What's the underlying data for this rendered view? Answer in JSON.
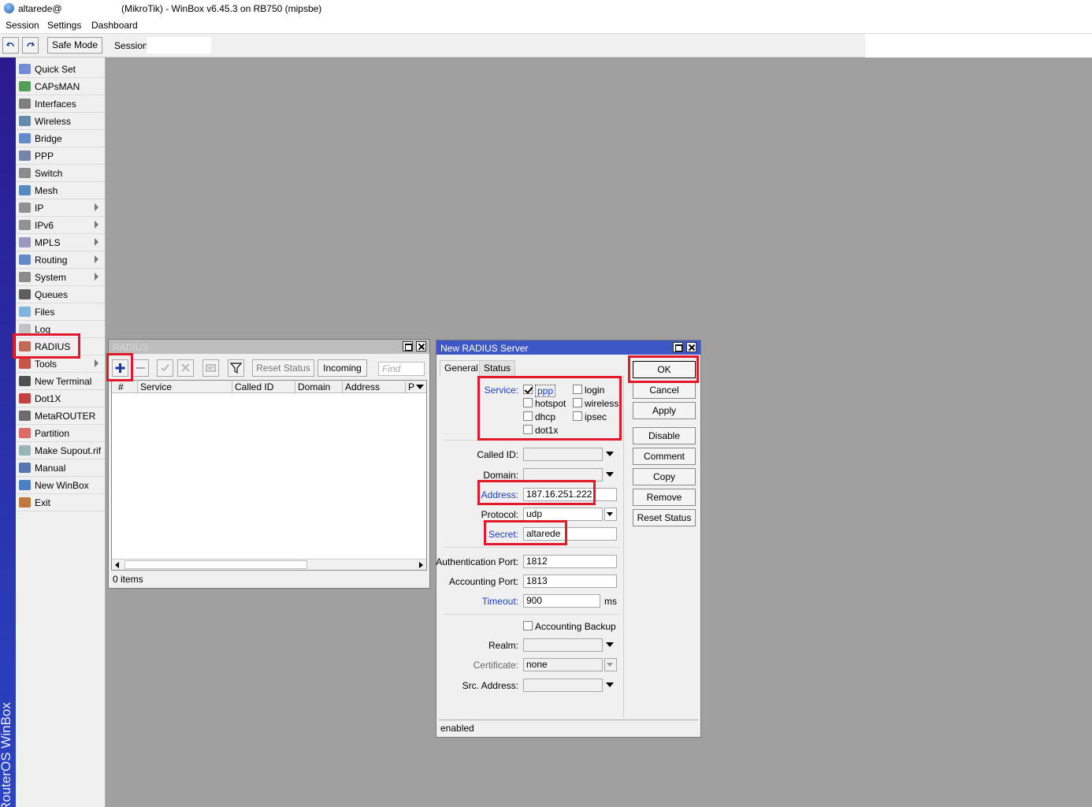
{
  "window": {
    "user": "altarede@",
    "title": "(MikroTik) - WinBox v6.45.3 on RB750 (mipsbe)"
  },
  "menu": [
    "Session",
    "Settings",
    "Dashboard"
  ],
  "toolbar": {
    "safe_mode": "Safe Mode",
    "session_label": "Session:",
    "session_value": ""
  },
  "brand_strip": "RouterOS WinBox",
  "sidebar": {
    "items": [
      {
        "label": "Quick Set",
        "icon": "quick-set-icon",
        "submenu": false
      },
      {
        "label": "CAPsMAN",
        "icon": "capsman-icon",
        "submenu": false
      },
      {
        "label": "Interfaces",
        "icon": "interfaces-icon",
        "submenu": false
      },
      {
        "label": "Wireless",
        "icon": "wireless-icon",
        "submenu": false
      },
      {
        "label": "Bridge",
        "icon": "bridge-icon",
        "submenu": false
      },
      {
        "label": "PPP",
        "icon": "ppp-icon",
        "submenu": false
      },
      {
        "label": "Switch",
        "icon": "switch-icon",
        "submenu": false
      },
      {
        "label": "Mesh",
        "icon": "mesh-icon",
        "submenu": false
      },
      {
        "label": "IP",
        "icon": "ip-icon",
        "submenu": true
      },
      {
        "label": "IPv6",
        "icon": "ipv6-icon",
        "submenu": true
      },
      {
        "label": "MPLS",
        "icon": "mpls-icon",
        "submenu": true
      },
      {
        "label": "Routing",
        "icon": "routing-icon",
        "submenu": true
      },
      {
        "label": "System",
        "icon": "system-icon",
        "submenu": true
      },
      {
        "label": "Queues",
        "icon": "queues-icon",
        "submenu": false
      },
      {
        "label": "Files",
        "icon": "files-icon",
        "submenu": false
      },
      {
        "label": "Log",
        "icon": "log-icon",
        "submenu": false
      },
      {
        "label": "RADIUS",
        "icon": "radius-icon",
        "submenu": false
      },
      {
        "label": "Tools",
        "icon": "tools-icon",
        "submenu": true
      },
      {
        "label": "New Terminal",
        "icon": "terminal-icon",
        "submenu": false
      },
      {
        "label": "Dot1X",
        "icon": "dot1x-icon",
        "submenu": false
      },
      {
        "label": "MetaROUTER",
        "icon": "metarouter-icon",
        "submenu": false
      },
      {
        "label": "Partition",
        "icon": "partition-icon",
        "submenu": false
      },
      {
        "label": "Make Supout.rif",
        "icon": "supout-icon",
        "submenu": false
      },
      {
        "label": "Manual",
        "icon": "manual-icon",
        "submenu": false
      },
      {
        "label": "New WinBox",
        "icon": "winbox-icon",
        "submenu": false
      },
      {
        "label": "Exit",
        "icon": "exit-icon",
        "submenu": false
      }
    ]
  },
  "radius_window": {
    "title": "RADIUS",
    "reset_status": "Reset Status",
    "incoming": "Incoming",
    "find_placeholder": "Find",
    "columns": [
      "#",
      "Service",
      "Called ID",
      "Domain",
      "Address",
      "P"
    ],
    "items_count": "0 items"
  },
  "new_radius": {
    "title": "New RADIUS Server",
    "tabs": [
      "General",
      "Status"
    ],
    "service_label": "Service:",
    "services": [
      {
        "label": "ppp",
        "checked": true
      },
      {
        "label": "login",
        "checked": false
      },
      {
        "label": "hotspot",
        "checked": false
      },
      {
        "label": "wireless",
        "checked": false
      },
      {
        "label": "dhcp",
        "checked": false
      },
      {
        "label": "ipsec",
        "checked": false
      },
      {
        "label": "dot1x",
        "checked": false
      }
    ],
    "called_id_label": "Called ID:",
    "called_id": "",
    "domain_label": "Domain:",
    "domain": "",
    "address_label": "Address:",
    "address": "187.16.251.222",
    "protocol_label": "Protocol:",
    "protocol": "udp",
    "secret_label": "Secret:",
    "secret": "altarede",
    "auth_port_label": "Authentication Port:",
    "auth_port": "1812",
    "acct_port_label": "Accounting Port:",
    "acct_port": "1813",
    "timeout_label": "Timeout:",
    "timeout": "900",
    "timeout_unit": "ms",
    "acct_backup_label": "Accounting Backup",
    "acct_backup": false,
    "realm_label": "Realm:",
    "realm": "",
    "certificate_label": "Certificate:",
    "certificate": "none",
    "src_address_label": "Src. Address:",
    "src_address": "",
    "buttons": {
      "ok": "OK",
      "cancel": "Cancel",
      "apply": "Apply",
      "disable": "Disable",
      "comment": "Comment",
      "copy": "Copy",
      "remove": "Remove",
      "reset_status": "Reset Status"
    },
    "status": "enabled"
  },
  "colors": {
    "highlight": "#e3192a",
    "active_title": "#3d58c6",
    "workspace": "#a0a0a0",
    "link_label": "#1b3dd6"
  }
}
